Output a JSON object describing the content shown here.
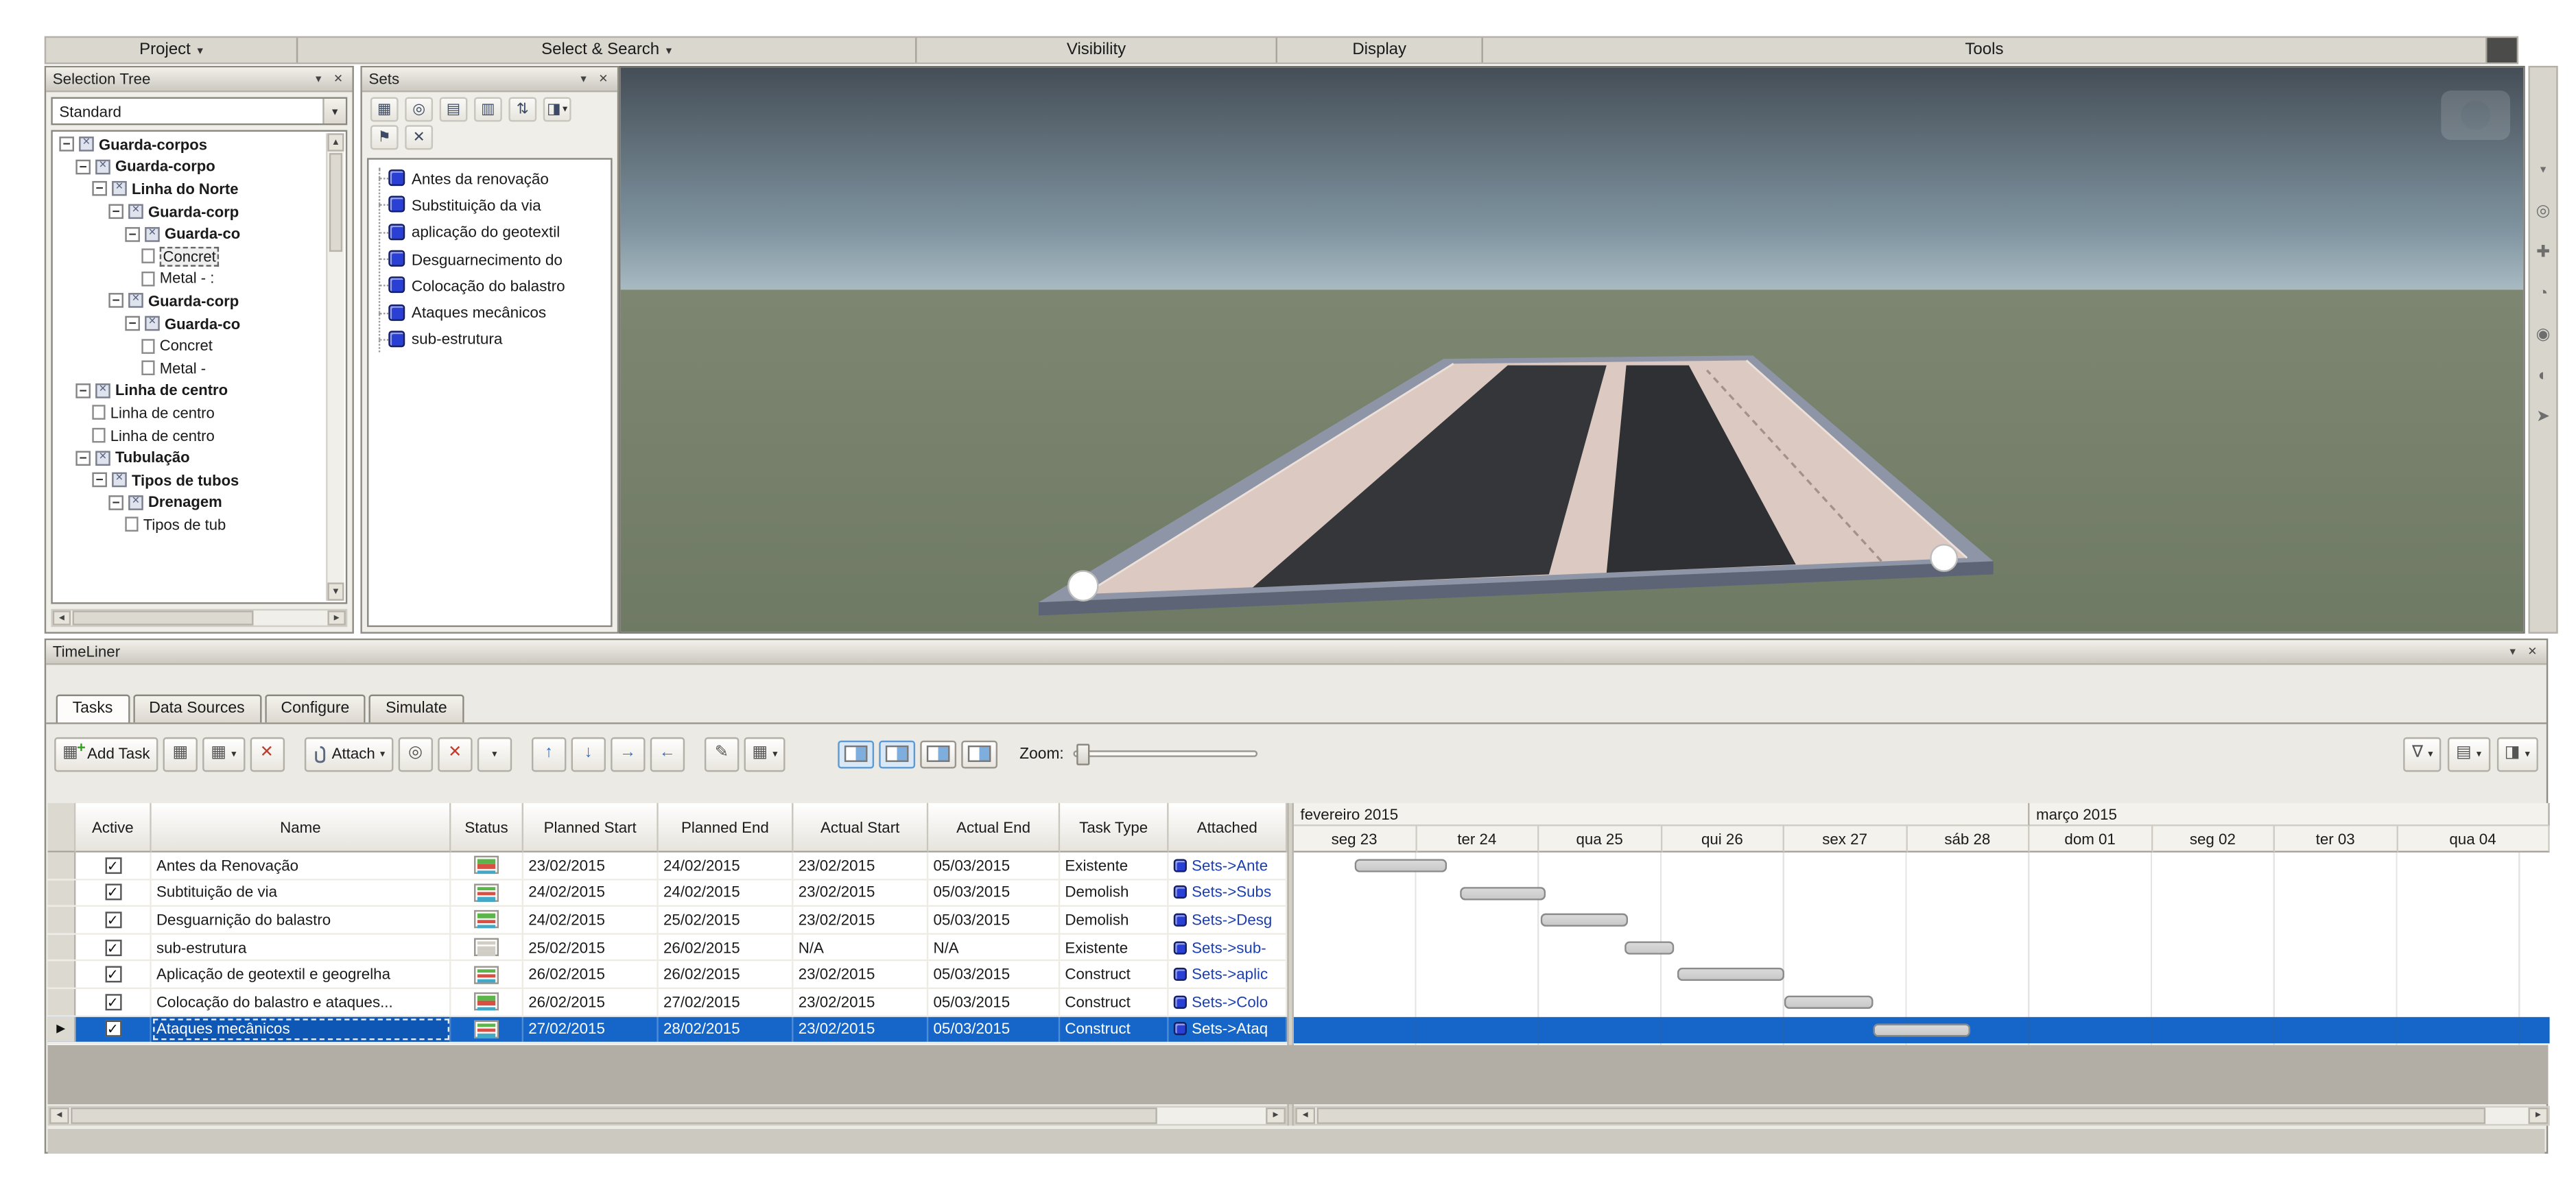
{
  "colors": {
    "selection_blue": "#1566c8",
    "gantt_bar": "#c9c9c9",
    "set_icon_blue": "#2a3fd4",
    "attached_link": "#1d3fae",
    "sky_top": "#454e57",
    "sky_bottom": "#a8bac2",
    "ground_green": "#79826c",
    "ballast_pink": "#dccac2"
  },
  "icons": {
    "dropdown": "▾",
    "minus": "−",
    "tree_glyph": "✕",
    "check": "✓",
    "row_marker": "▶",
    "close": "✕",
    "pin": "▾",
    "scroll_left": "◄",
    "scroll_right": "►",
    "scroll_up": "▲",
    "scroll_down": "▼",
    "grid": "▦",
    "add_plus": "+",
    "delete_x": "✕",
    "find": "◎",
    "export": "▤",
    "duplicate": "▥",
    "sort": "⇅",
    "options": "◨",
    "flag": "⚑",
    "pencil": "✎",
    "arrow_up": "↑",
    "arrow_down": "↓",
    "arrow_right": "→",
    "arrow_left": "←",
    "funnel": "∇",
    "nav_wheel": "◎",
    "nav_pan": "✚",
    "nav_zoom": "◔",
    "nav_orbit": "◉",
    "nav_look": "◐",
    "nav_select": "➤"
  },
  "ribbon": {
    "sections": [
      {
        "label": "Project",
        "dropdown": true
      },
      {
        "label": "Select & Search",
        "dropdown": true
      },
      {
        "label": "Visibility",
        "dropdown": false
      },
      {
        "label": "Display",
        "dropdown": false
      },
      {
        "label": "Tools",
        "dropdown": false
      }
    ]
  },
  "selection_tree": {
    "title": "Selection Tree",
    "mode": "Standard",
    "items": [
      {
        "label": "Guarda-corpos",
        "level": 0,
        "type": "group"
      },
      {
        "label": "Guarda-corpo",
        "level": 1,
        "type": "group"
      },
      {
        "label": "Linha do Norte",
        "level": 2,
        "type": "group"
      },
      {
        "label": "Guarda-corp",
        "level": 3,
        "type": "group"
      },
      {
        "label": "Guarda-co",
        "level": 4,
        "type": "group"
      },
      {
        "label": "Concret",
        "level": 5,
        "type": "leaf",
        "selected": true
      },
      {
        "label": "Metal - :",
        "level": 5,
        "type": "leaf"
      },
      {
        "label": "Guarda-corp",
        "level": 3,
        "type": "group"
      },
      {
        "label": "Guarda-co",
        "level": 4,
        "type": "group"
      },
      {
        "label": "Concret",
        "level": 5,
        "type": "leaf"
      },
      {
        "label": "Metal -",
        "level": 5,
        "type": "leaf"
      },
      {
        "label": "Linha de centro",
        "level": 1,
        "type": "group"
      },
      {
        "label": "Linha de centro",
        "level": 2,
        "type": "leaf"
      },
      {
        "label": "Linha de centro",
        "level": 2,
        "type": "leaf"
      },
      {
        "label": "Tubulação",
        "level": 1,
        "type": "group"
      },
      {
        "label": "Tipos de tubos",
        "level": 2,
        "type": "group"
      },
      {
        "label": "Drenagem",
        "level": 3,
        "type": "group"
      },
      {
        "label": "Tipos de tub",
        "level": 4,
        "type": "leaf"
      }
    ]
  },
  "sets": {
    "title": "Sets",
    "items": [
      "Antes da renovação",
      "Substituição da via",
      "aplicação do geotextil",
      "Desguarnecimento do",
      "Colocação do balastro",
      "Ataques mecânicos",
      "sub-estrutura"
    ]
  },
  "timeliner": {
    "title": "TimeLiner",
    "tabs": [
      "Tasks",
      "Data Sources",
      "Configure",
      "Simulate"
    ],
    "active_tab": "Tasks",
    "toolbar": {
      "add_task_label": "Add Task",
      "attach_label": "Attach",
      "zoom_label": "Zoom:"
    },
    "grid": {
      "columns": [
        "Active",
        "Name",
        "Status",
        "Planned Start",
        "Planned End",
        "Actual Start",
        "Actual End",
        "Task Type",
        "Attached"
      ],
      "rows": [
        {
          "active": true,
          "name": "Antes da Renovação",
          "status": "colored",
          "planned_start": "23/02/2015",
          "planned_end": "24/02/2015",
          "actual_start": "23/02/2015",
          "actual_end": "05/03/2015",
          "task_type": "Existente",
          "attached": "Sets->Ante",
          "selected": false
        },
        {
          "active": true,
          "name": "Subtituição de via",
          "status": "colored",
          "planned_start": "24/02/2015",
          "planned_end": "24/02/2015",
          "actual_start": "23/02/2015",
          "actual_end": "05/03/2015",
          "task_type": "Demolish",
          "attached": "Sets->Subs",
          "selected": false
        },
        {
          "active": true,
          "name": "Desguarnição do balastro",
          "status": "colored",
          "planned_start": "24/02/2015",
          "planned_end": "25/02/2015",
          "actual_start": "23/02/2015",
          "actual_end": "05/03/2015",
          "task_type": "Demolish",
          "attached": "Sets->Desg",
          "selected": false
        },
        {
          "active": true,
          "name": "sub-estrutura",
          "status": "plain",
          "planned_start": "25/02/2015",
          "planned_end": "26/02/2015",
          "actual_start": "N/A",
          "actual_end": "N/A",
          "task_type": "Existente",
          "attached": "Sets->sub-",
          "selected": false
        },
        {
          "active": true,
          "name": "Aplicação de geotextil e geogrelha",
          "status": "colored",
          "planned_start": "26/02/2015",
          "planned_end": "26/02/2015",
          "actual_start": "23/02/2015",
          "actual_end": "05/03/2015",
          "task_type": "Construct",
          "attached": "Sets->aplic",
          "selected": false
        },
        {
          "active": true,
          "name": "Colocação do balastro e ataques...",
          "status": "colored",
          "planned_start": "26/02/2015",
          "planned_end": "27/02/2015",
          "actual_start": "23/02/2015",
          "actual_end": "05/03/2015",
          "task_type": "Construct",
          "attached": "Sets->Colo",
          "selected": false
        },
        {
          "active": true,
          "name": "Ataques mecânicos",
          "status": "colored",
          "planned_start": "27/02/2015",
          "planned_end": "28/02/2015",
          "actual_start": "23/02/2015",
          "actual_end": "05/03/2015",
          "task_type": "Construct",
          "attached": "Sets->Ataq",
          "selected": true
        }
      ]
    },
    "gantt": {
      "months": [
        {
          "label": "fevereiro 2015",
          "days": 6
        },
        {
          "label": "março 2015",
          "days": 4
        }
      ],
      "day_headers": [
        "seg 23",
        "ter 24",
        "qua 25",
        "qui 26",
        "sex 27",
        "sáb 28",
        "dom 01",
        "seg 02",
        "ter 03",
        "qua 04"
      ],
      "bars": [
        {
          "task": "Antes da Renovação",
          "start_day": 0.5,
          "end_day": 1.25
        },
        {
          "task": "Subtituição de via",
          "start_day": 1.35,
          "end_day": 2.05
        },
        {
          "task": "Desguarnição do balastro",
          "start_day": 2.02,
          "end_day": 2.73
        },
        {
          "task": "sub-estrutura",
          "start_day": 2.7,
          "end_day": 3.1
        },
        {
          "task": "Aplicação de geotextil e geogrelha",
          "start_day": 3.13,
          "end_day": 4.0
        },
        {
          "task": "Colocação do balastro e ataques...",
          "start_day": 4.0,
          "end_day": 4.72
        },
        {
          "task": "Ataques mecânicos",
          "start_day": 4.73,
          "end_day": 5.52
        }
      ]
    }
  }
}
